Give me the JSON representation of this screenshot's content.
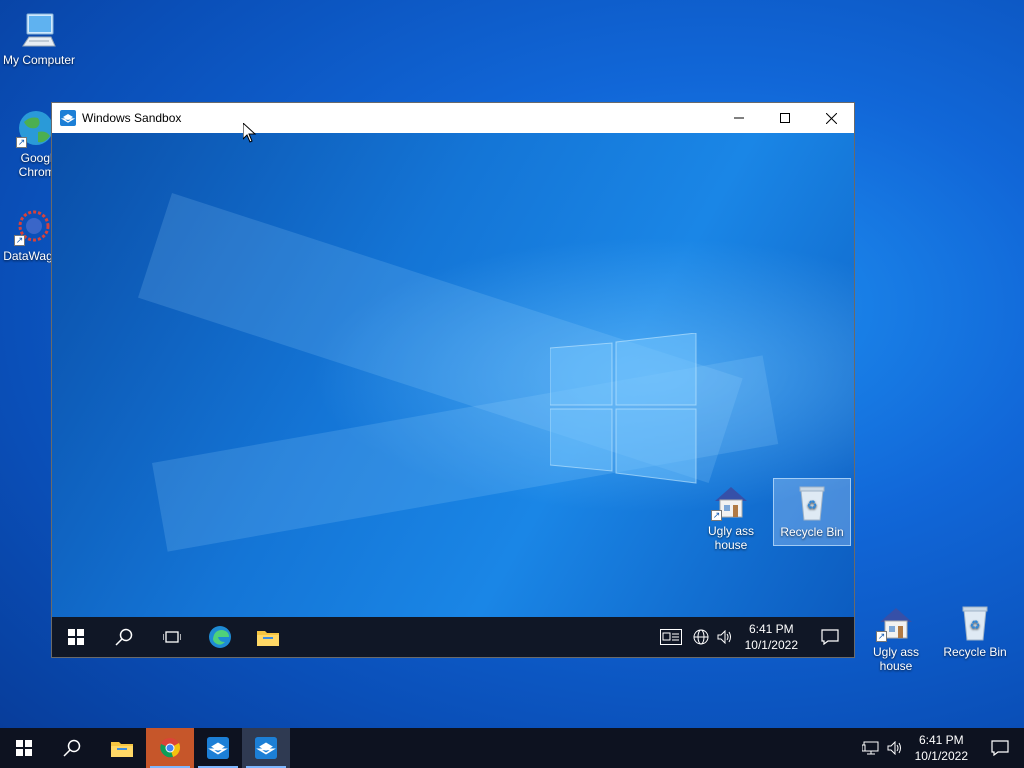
{
  "desktop_icons": [
    {
      "id": "my-computer",
      "label": "My Computer"
    },
    {
      "id": "google-chrome",
      "label": "Google Chrome"
    },
    {
      "id": "datawag",
      "label": "DataWag"
    },
    {
      "id": "ugly-house",
      "label": "Ugly ass house"
    },
    {
      "id": "recycle-bin",
      "label": "Recycle Bin"
    }
  ],
  "window": {
    "title": "Windows Sandbox",
    "inner_icons": [
      {
        "id": "ugly-house",
        "label": "Ugly ass house"
      },
      {
        "id": "recycle-bin",
        "label": "Recycle Bin",
        "selected": true
      }
    ],
    "taskbar": {
      "time": "6:41 PM",
      "date": "10/1/2022",
      "items": [
        "start",
        "search",
        "task-view",
        "edge",
        "file-explorer"
      ]
    }
  },
  "taskbar": {
    "time": "6:41 PM",
    "date": "10/1/2022",
    "items": [
      "start",
      "search",
      "file-explorer",
      "chrome",
      "windows-sandbox",
      "windows-sandbox"
    ]
  },
  "colors": {
    "accent": "#0078d7",
    "taskbar": "#0d1220",
    "chrome_active": "#c6562a"
  }
}
